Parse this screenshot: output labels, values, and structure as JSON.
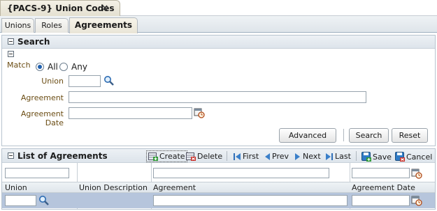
{
  "window_tab": {
    "title": "{PACS-9} Union Codes",
    "close": "×"
  },
  "subtabs": [
    {
      "label": "Unions"
    },
    {
      "label": "Roles"
    },
    {
      "label": "Agreements"
    }
  ],
  "search": {
    "title": "Search",
    "match_label": "Match",
    "match_options": [
      "All",
      "Any"
    ],
    "match_selected": "All",
    "union_label": "Union",
    "agreement_label": "Agreement",
    "agreement_date_label": "Agreement Date",
    "buttons": {
      "advanced": "Advanced",
      "search": "Search",
      "reset": "Reset"
    }
  },
  "list": {
    "title": "List of Agreements",
    "toolbar": {
      "create": "Create",
      "delete": "Delete",
      "first": "First",
      "prev": "Prev",
      "next": "Next",
      "last": "Last",
      "save": "Save",
      "cancel": "Cancel"
    },
    "columns": [
      "Union",
      "Union Description",
      "Agreement",
      "Agreement Date"
    ]
  },
  "colors": {
    "accent": "#1f5fae",
    "selected_row": "#b6c5dc",
    "label": "#6b4d14"
  }
}
